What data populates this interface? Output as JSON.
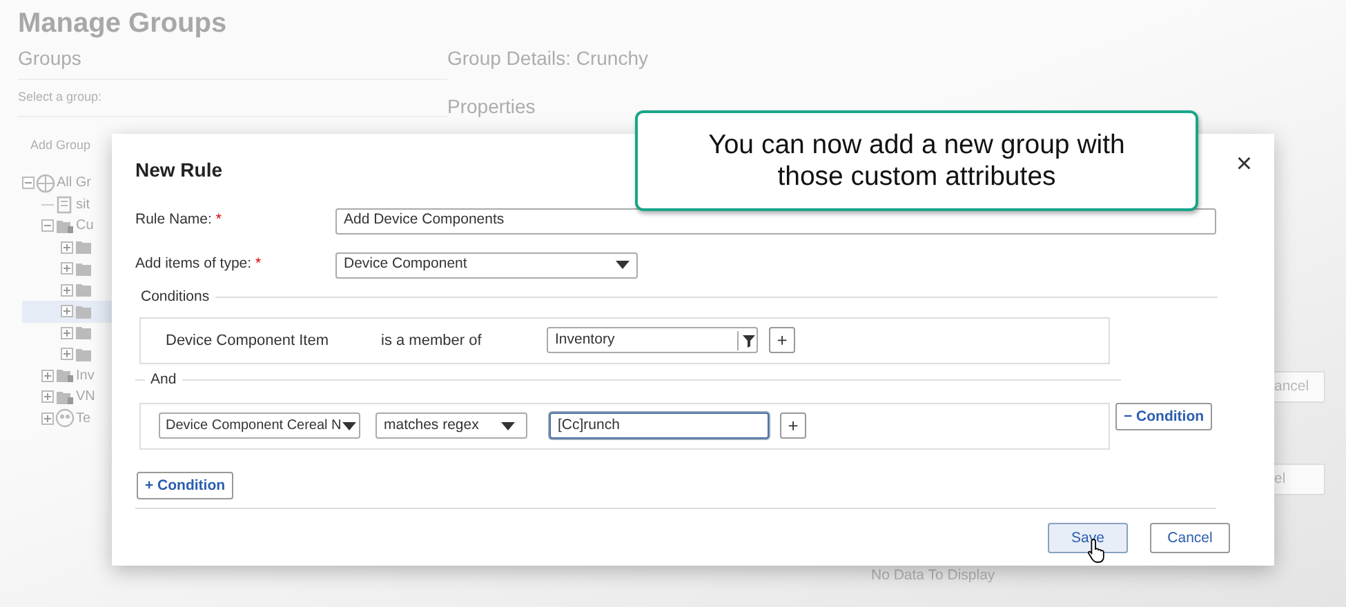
{
  "background": {
    "title": "Manage Groups",
    "groups_heading": "Groups",
    "select_label": "Select a group:",
    "add_group_button": "Add Group",
    "tree": [
      {
        "label": "All Gr",
        "kind": "globe",
        "expanded": true,
        "selected": false,
        "children": [
          {
            "label": "sit",
            "kind": "building",
            "selected": false
          },
          {
            "label": "Cu",
            "kind": "locked",
            "expanded": true,
            "selected": false,
            "children": [
              {
                "kind": "folder",
                "expanded": false,
                "selected": false
              },
              {
                "kind": "folder",
                "expanded": false,
                "selected": false
              },
              {
                "kind": "folder",
                "expanded": false,
                "selected": false
              },
              {
                "kind": "folder",
                "expanded": false,
                "selected": true
              },
              {
                "kind": "folder",
                "expanded": false,
                "selected": false
              },
              {
                "kind": "folder",
                "expanded": false,
                "selected": false
              }
            ]
          },
          {
            "label": "Inv",
            "kind": "locked",
            "expanded": false,
            "selected": false
          },
          {
            "label": "VN",
            "kind": "locked",
            "expanded": false,
            "selected": false
          },
          {
            "label": "Te",
            "kind": "people",
            "expanded": false,
            "selected": false
          }
        ]
      }
    ],
    "details_heading": "Group Details: Crunchy",
    "properties_heading": "Properties",
    "buttons": [
      "ancel",
      "el"
    ],
    "empty_message": "No Data To Display"
  },
  "dialog": {
    "title": "New Rule",
    "close": "×",
    "fields": [
      {
        "kind": "text",
        "label": "Rule Name:",
        "required_mark": "*",
        "value": "Add Device Components"
      },
      {
        "kind": "select",
        "label": "Add items of type:",
        "required_mark": "*",
        "value": "Device Component"
      }
    ],
    "conditions_legend": "Conditions",
    "conditions": [
      {
        "kind": "fixed",
        "field": "Device Component Item",
        "operator": "is a member of",
        "value": "Inventory",
        "add": "+"
      },
      {
        "kind": "editable",
        "join": "And",
        "field": "Device Component Cereal N",
        "operator": "matches regex",
        "value": "[Cc]runch",
        "focused": true,
        "add": "+",
        "remove": "− Condition"
      }
    ],
    "add_condition": "+ Condition",
    "buttons": [
      {
        "label": "Save",
        "hovered": true
      },
      {
        "label": "Cancel",
        "hovered": false
      }
    ]
  },
  "callout": {
    "text": "You can now add a new group with those custom attributes"
  }
}
